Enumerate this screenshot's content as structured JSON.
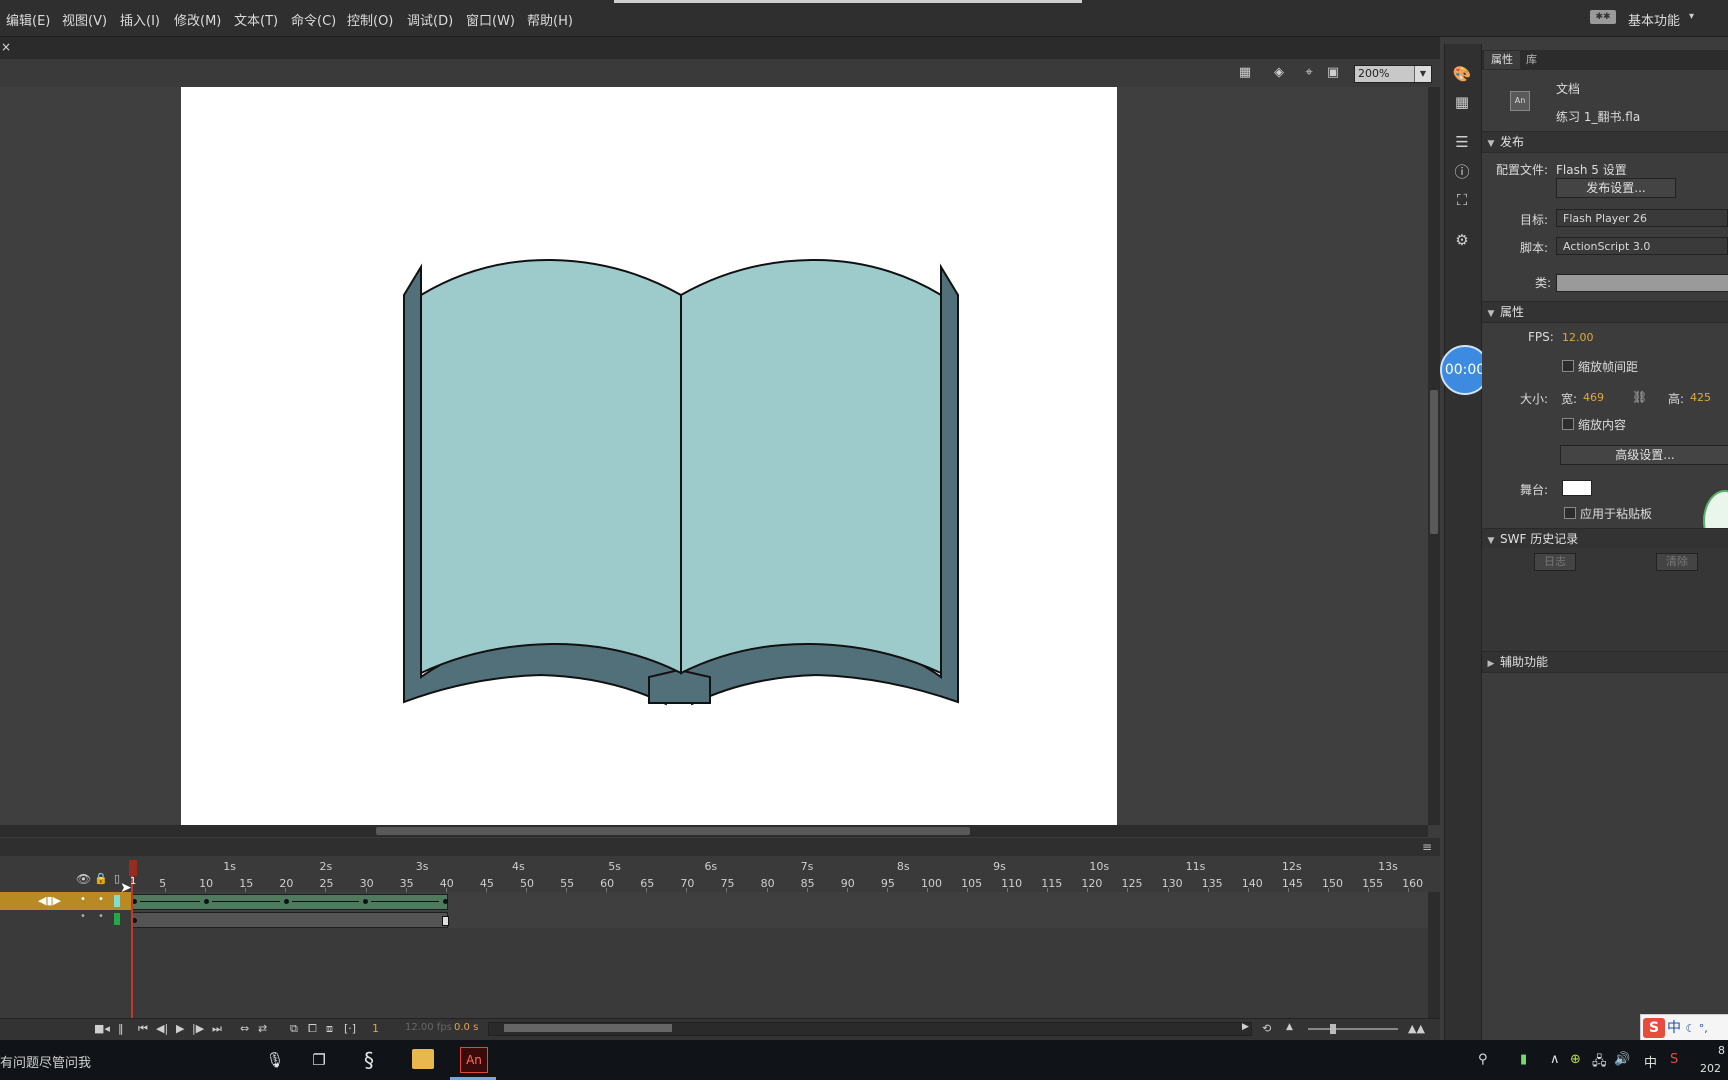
{
  "menu": {
    "items": [
      "编辑(E)",
      "视图(V)",
      "插入(I)",
      "修改(M)",
      "文本(T)",
      "命令(C)",
      "控制(O)",
      "调试(D)",
      "窗口(W)",
      "帮助(H)"
    ],
    "workspace": "基本功能",
    "workspace_caret": "▾"
  },
  "doc_tab": {
    "close": "×"
  },
  "editbar": {
    "zoom": "200%",
    "zoom_caret": "▼"
  },
  "timer": "00:00",
  "panel": {
    "tabs": {
      "properties": "属性",
      "library": "库"
    },
    "doc_icon": "An",
    "doc_type": "文档",
    "file_name": "练习 1_翻书.fla",
    "publish": {
      "header": "发布",
      "profile_label": "配置文件:",
      "profile_value": "Flash 5 设置",
      "settings_button": "发布设置...",
      "target_label": "目标:",
      "target_value": "Flash Player 26",
      "script_label": "脚本:",
      "script_value": "ActionScript 3.0",
      "class_label": "类:"
    },
    "properties": {
      "header": "属性",
      "fps_label": "FPS:",
      "fps_value": "12.00",
      "scale_spans": "缩放帧间距",
      "size_label": "大小:",
      "width_label": "宽:",
      "width_value": "469",
      "height_label": "高:",
      "height_value": "425",
      "scale_content": "缩放内容",
      "advanced_button": "高级设置...",
      "stage_label": "舞台:",
      "apply_pasteboard": "应用于粘贴板"
    },
    "swf": {
      "header": "SWF 历史记录",
      "log_button": "日志",
      "clear_button": "清除"
    },
    "accessibility": {
      "header": "辅助功能"
    }
  },
  "timeline": {
    "seconds": [
      "1s",
      "2s",
      "3s",
      "4s",
      "5s",
      "6s",
      "7s",
      "8s",
      "9s",
      "10s",
      "11s",
      "12s",
      "13s"
    ],
    "frames": [
      "5",
      "10",
      "15",
      "20",
      "25",
      "30",
      "35",
      "40",
      "45",
      "50",
      "55",
      "60",
      "65",
      "70",
      "75",
      "80",
      "85",
      "90",
      "95",
      "100",
      "105",
      "110",
      "115",
      "120",
      "125",
      "130",
      "135",
      "140",
      "145",
      "150",
      "155",
      "160"
    ],
    "current_frame_marker": "1",
    "status_frame": "1",
    "status_fps": "12.00 fps",
    "status_time": "0.0 s"
  },
  "taskbar": {
    "search_text": "有问题尽管问我",
    "an_label": "An",
    "tray_lang": "中",
    "clock_year": "202",
    "clock_digit": "8"
  },
  "ime": {
    "logo": "S",
    "lang": "中",
    "extra": "☾ °,"
  },
  "colors": {
    "page_fill": "#9dcbcb",
    "cover_fill": "#52707a",
    "layer_active": "#b78a23",
    "tween": "#4e7a5e",
    "playhead": "#c0392b",
    "value_orange": "#e0a83a"
  }
}
